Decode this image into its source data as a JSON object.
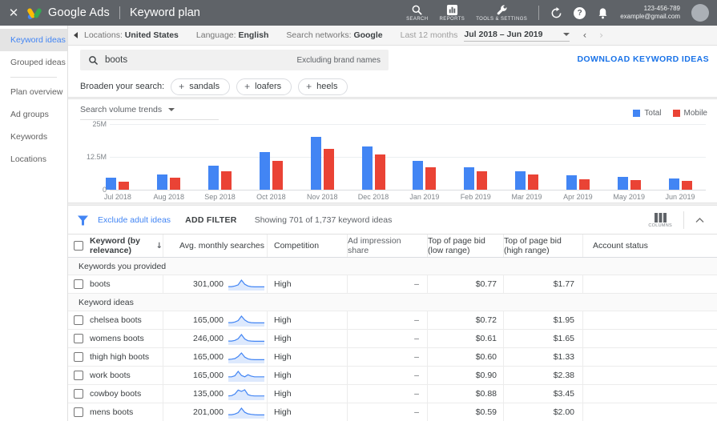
{
  "colors": {
    "topbar_bg": "#5f6368",
    "accent_blue": "#4285f4",
    "link_blue": "#1a73e8",
    "bar_red": "#ea4335",
    "spark_fill": "rgba(66,133,244,0.18)"
  },
  "topbar": {
    "close": "✕",
    "brand": "Google Ads",
    "page_title": "Keyword plan",
    "nav": [
      {
        "label": "SEARCH"
      },
      {
        "label": "REPORTS"
      },
      {
        "label": "TOOLS & SETTINGS"
      }
    ],
    "account": {
      "id": "123-456-789",
      "email": "example@gmail.com"
    }
  },
  "subheader": {
    "locations_label": "Locations:",
    "locations_value": "United States",
    "language_label": "Language:",
    "language_value": "English",
    "networks_label": "Search networks:",
    "networks_value": "Google",
    "period_label": "Last 12 months",
    "period_value": "Jul 2018 – Jun 2019",
    "prev": "‹",
    "next": "›"
  },
  "sidebar": {
    "items": [
      {
        "label": "Keyword ideas",
        "selected": true
      },
      {
        "label": "Grouped ideas",
        "selected": false
      },
      {
        "label": "Plan overview",
        "selected": false
      },
      {
        "label": "Ad groups",
        "selected": false
      },
      {
        "label": "Keywords",
        "selected": false
      },
      {
        "label": "Locations",
        "selected": false
      }
    ],
    "divider_after_index": 1
  },
  "search": {
    "query": "boots",
    "note": "Excluding brand names",
    "download_label": "DOWNLOAD KEYWORD IDEAS"
  },
  "broaden": {
    "label": "Broaden your search:",
    "chips": [
      "sandals",
      "loafers",
      "heels"
    ]
  },
  "chart_data": {
    "type": "bar",
    "title": "Search volume trends",
    "categories": [
      "Jul 2018",
      "Aug 2018",
      "Sep 2018",
      "Oct 2018",
      "Nov 2018",
      "Dec 2018",
      "Jan 2019",
      "Feb 2019",
      "Mar 2019",
      "Apr 2019",
      "May 2019",
      "Jun 2019"
    ],
    "series": [
      {
        "name": "Total",
        "color": "#4285f4",
        "values": [
          4.5,
          5.8,
          9.0,
          14.2,
          20.2,
          16.6,
          11.0,
          8.4,
          7.0,
          5.4,
          5.0,
          4.3
        ]
      },
      {
        "name": "Mobile",
        "color": "#ea4335",
        "values": [
          3.2,
          4.5,
          7.0,
          11.0,
          15.5,
          13.4,
          8.6,
          6.9,
          5.7,
          4.0,
          3.7,
          3.4
        ]
      }
    ],
    "unit": "millions",
    "ylim": [
      0,
      25
    ],
    "yticks": [
      {
        "label": "25M",
        "value": 25
      },
      {
        "label": "12.5M",
        "value": 12.5
      },
      {
        "label": "0",
        "value": 0
      }
    ],
    "legend_position": "top-right",
    "grid": true
  },
  "filterbar": {
    "exclude_link": "Exclude adult ideas",
    "add_filter": "ADD FILTER",
    "showing": "Showing 701 of 1,737 keyword ideas",
    "columns_label": "COLUMNS"
  },
  "table": {
    "headers": [
      "Keyword (by relevance)",
      "Avg. monthly searches",
      "Competition",
      "Ad impression share",
      "Top of page bid (low range)",
      "Top of page bid (high range)",
      "Account status"
    ],
    "sort_arrow": "↓",
    "sections": [
      {
        "title": "Keywords you provided",
        "rows": [
          {
            "keyword": "boots",
            "searches": "301,000",
            "trend": [
              8,
              8,
              10,
              14,
              30,
              16,
              10,
              8,
              7,
              7,
              7,
              7
            ],
            "competition": "High",
            "ad_impression_share": "–",
            "bid_low": "$0.77",
            "bid_high": "$1.77",
            "account_status": ""
          }
        ]
      },
      {
        "title": "Keyword ideas",
        "rows": [
          {
            "keyword": "chelsea boots",
            "searches": "165,000",
            "trend": [
              8,
              8,
              10,
              15,
              30,
              17,
              10,
              8,
              7,
              7,
              7,
              7
            ],
            "competition": "High",
            "ad_impression_share": "–",
            "bid_low": "$0.72",
            "bid_high": "$1.95",
            "account_status": ""
          },
          {
            "keyword": "womens boots",
            "searches": "246,000",
            "trend": [
              8,
              8,
              10,
              16,
              30,
              15,
              9,
              8,
              7,
              7,
              7,
              7
            ],
            "competition": "High",
            "ad_impression_share": "–",
            "bid_low": "$0.61",
            "bid_high": "$1.65",
            "account_status": ""
          },
          {
            "keyword": "thigh high boots",
            "searches": "165,000",
            "trend": [
              8,
              9,
              11,
              18,
              30,
              16,
              10,
              8,
              7,
              7,
              7,
              7
            ],
            "competition": "High",
            "ad_impression_share": "–",
            "bid_low": "$0.60",
            "bid_high": "$1.33",
            "account_status": ""
          },
          {
            "keyword": "work boots",
            "searches": "165,000",
            "trend": [
              10,
              10,
              13,
              26,
              14,
              10,
              16,
              12,
              10,
              10,
              10,
              10
            ],
            "competition": "High",
            "ad_impression_share": "–",
            "bid_low": "$0.90",
            "bid_high": "$2.38",
            "account_status": ""
          },
          {
            "keyword": "cowboy boots",
            "searches": "135,000",
            "trend": [
              8,
              9,
              14,
              26,
              22,
              27,
              12,
              9,
              8,
              8,
              8,
              8
            ],
            "competition": "High",
            "ad_impression_share": "–",
            "bid_low": "$0.88",
            "bid_high": "$3.45",
            "account_status": ""
          },
          {
            "keyword": "mens boots",
            "searches": "201,000",
            "trend": [
              8,
              8,
              10,
              15,
              30,
              16,
              11,
              9,
              8,
              7,
              7,
              7
            ],
            "competition": "High",
            "ad_impression_share": "–",
            "bid_low": "$0.59",
            "bid_high": "$2.00",
            "account_status": ""
          }
        ]
      }
    ]
  }
}
